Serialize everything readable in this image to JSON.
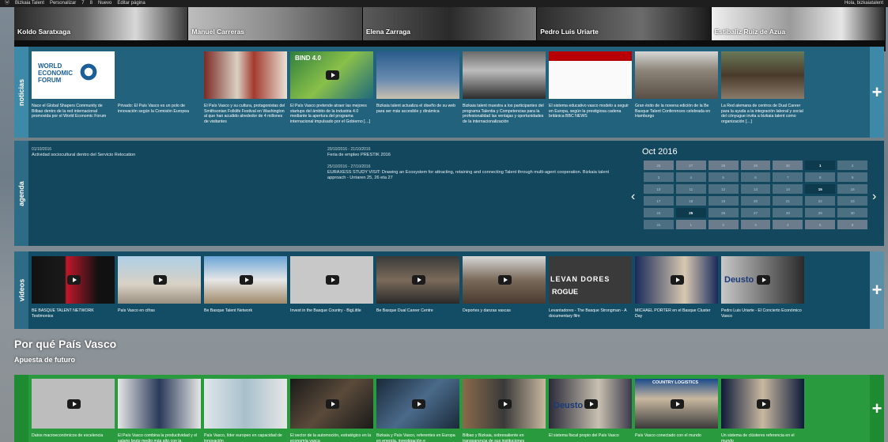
{
  "adminbar": {
    "items": [
      "Bizkaia Talent",
      "Personalizar",
      "7",
      "8",
      "Nuevo",
      "Editar página"
    ],
    "user": "Hola, bizkaiatalent"
  },
  "people": [
    "Koldo Saratxaga",
    "Manuel Carreras",
    "Elena Zarraga",
    "Pedro Luis Uriarte",
    "Estibaliz Ruiz de Azua"
  ],
  "noticias": {
    "label": "noticias",
    "plus": "+",
    "items": [
      "Nace el Global Shapers Community de Bilbao dentro de la red internacional promovida por el World Economic Forum",
      "Privado: El País Vasco es un polo de innovación según la Comisión Europea",
      "El País Vasco y su cultura, protagonistas del Smithsonian Folklife Festival en Washington al que han acudido alrededor de 4 millones de visitantes",
      "El País Vasco pretende atraer las mejores startups del ámbito de la industria 4.0 mediante la apertura del programa internacional impulsado por el Gobierno […]",
      "Bizkaia talent actualiza el diseño de su web para ser más accesible y dinámica",
      "Bizkaia talent muestra a los participantes del programa Talentia y Competencias para la profesionalidad las ventajas y oportunidades de la internacionalización",
      "El sistema educativo vasco modelo a seguir en Europa, según la prestigiosa cadena británica BBC NEWS",
      "Gran éxito de la novena edición de la Be Basque Talent Conferences celebrada en Hamburgo",
      "La Red alemana de centros de Dual Career para la ayuda a la integración laboral y social del cónyugue invita a bizkaia talent como organización […]"
    ],
    "thumb_text": {
      "wef": [
        "WORLD",
        "ECONOMIC",
        "FORUM"
      ],
      "bind": "BIND 4.0"
    }
  },
  "agenda": {
    "label": "agenda",
    "events": [
      {
        "date": "01/10/2016",
        "title": "Actividad sociocultural dentro del Servicio Relocation"
      },
      {
        "date": "20/10/2016 - 21/10/2016",
        "title": "Feria de empleo PRESTIK 2016"
      },
      {
        "date": "25/10/2016 - 27/10/2016",
        "title": "EURAXESS STUDY VISIT: Drawing an Ecosystem for attracting, retaining and connecting Talent through multi-agent cooperation. Bizkaia talent approach - Urriaren 25, 26 eta 27"
      }
    ],
    "calendar": {
      "title": "Oct 2016",
      "prev": "‹",
      "next": "›",
      "days": [
        "26",
        "27",
        "28",
        "29",
        "30",
        "1",
        "2",
        "3",
        "4",
        "5",
        "6",
        "7",
        "8",
        "9",
        "10",
        "11",
        "12",
        "13",
        "14",
        "15",
        "16",
        "17",
        "18",
        "19",
        "20",
        "21",
        "22",
        "23",
        "24",
        "25",
        "26",
        "27",
        "28",
        "29",
        "30",
        "31",
        "1",
        "2",
        "3",
        "4",
        "5",
        "6"
      ],
      "other_month": [
        0,
        1,
        2,
        3,
        4,
        36,
        37,
        38,
        39,
        40,
        41
      ],
      "highlight": [
        5,
        19,
        29
      ]
    }
  },
  "videos": {
    "label": "videos",
    "plus": "+",
    "items": [
      "BE BASQUE TALENT NETWORK Testimonios",
      "País Vasco en cifras",
      "Be Basque Talent Network",
      "Invest in the Basque Country - BigLittle",
      "Be Basque Dual Career Centre",
      "Deportes y danzas vascas",
      "Levantadores - The Basque Strongman - A documentary film",
      "MICHAEL PORTER en el Basque Cluster Day",
      "Pedro Luis Uriarte - El Concierto Económico Vasco"
    ],
    "thumb_text": {
      "levan": "LEVAN DORES",
      "rogue": "ROGUE",
      "deusto": "Deusto"
    }
  },
  "porque": {
    "title": "Por qué País Vasco",
    "subtitle": "Apuesta de futuro"
  },
  "futuro": {
    "plus": "+",
    "items": [
      "Datos macroeconómicos de excelencia",
      "El País Vasco combina la productividad y el salario bruto medio más alto con la",
      "País Vasco, líder europeo en capacidad de innovación",
      "El sector de la automoción, estratégico en la economía vasca",
      "Bizkaia y País Vasco, referentes en Europa en energía, investigación e",
      "Bilbao y Bizkaia, sobresaliente en transparencia de sus instituciones",
      "El sistema fiscal propio del País Vasco",
      "País Vasco conectado con el mundo",
      "Un sistema de clústeres referencia en el mundo"
    ],
    "thumb_text": {
      "deusto": "Deusto",
      "logistics": "COUNTRY LOGISTICS"
    }
  }
}
